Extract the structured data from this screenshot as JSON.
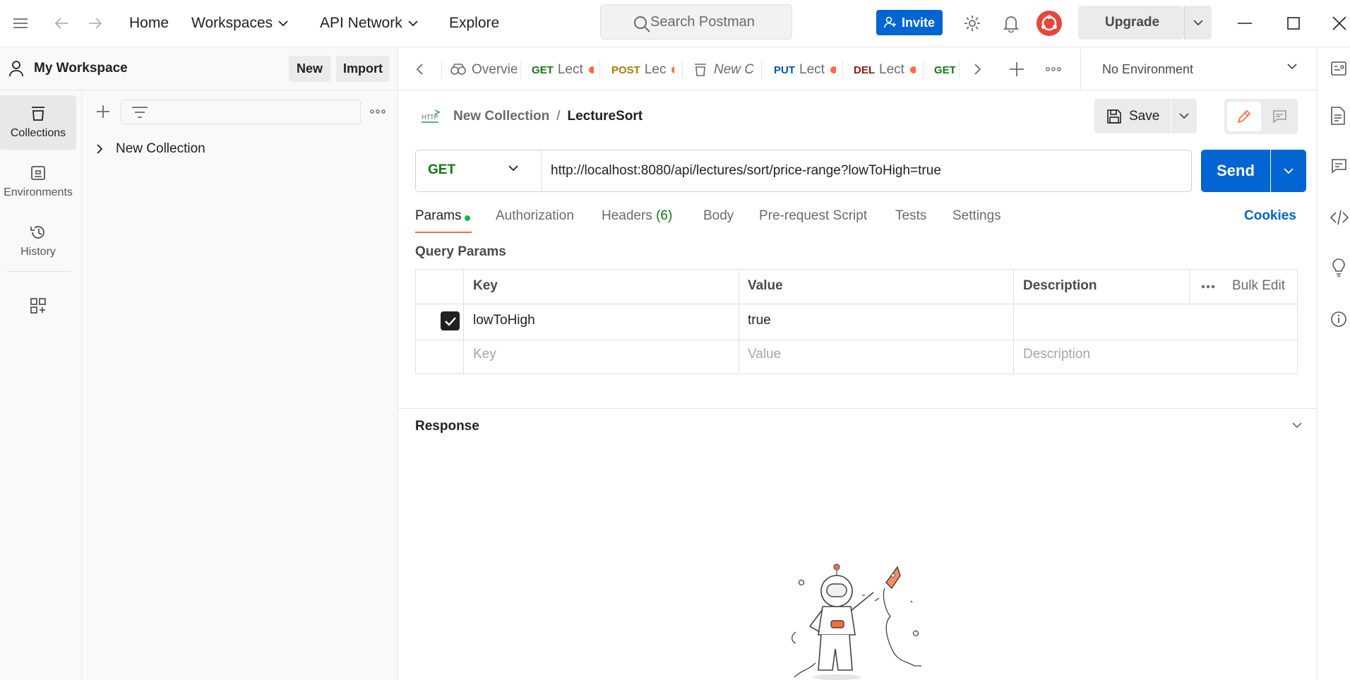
{
  "topbar": {
    "nav": {
      "home": "Home",
      "workspaces": "Workspaces",
      "api_network": "API Network",
      "explore": "Explore"
    },
    "search_placeholder": "Search Postman",
    "invite_label": "Invite",
    "upgrade_label": "Upgrade"
  },
  "workspace": {
    "title": "My Workspace",
    "new_label": "New",
    "import_label": "Import"
  },
  "rail": [
    {
      "label": "Collections",
      "icon": "collections-icon",
      "active": true
    },
    {
      "label": "Environments",
      "icon": "environments-icon",
      "active": false
    },
    {
      "label": "History",
      "icon": "history-icon",
      "active": false
    }
  ],
  "sidebar": {
    "collections": [
      {
        "name": "New Collection"
      }
    ]
  },
  "tabs": [
    {
      "method": "",
      "label": "Overvie",
      "dot": false
    },
    {
      "method": "GET",
      "label": "Lect",
      "dot": true
    },
    {
      "method": "POST",
      "label": "Lec",
      "dot": true
    },
    {
      "method": "",
      "label": "New C",
      "dot": false
    },
    {
      "method": "PUT",
      "label": "Lect",
      "dot": true
    },
    {
      "method": "DEL",
      "label": "Lect",
      "dot": true
    },
    {
      "method": "GET",
      "label": "",
      "dot": false
    }
  ],
  "environment": {
    "selected": "No Environment"
  },
  "request": {
    "breadcrumb": {
      "parent": "New Collection",
      "separator": "/",
      "current": "LectureSort"
    },
    "save_label": "Save",
    "method": "GET",
    "url": "http://localhost:8080/api/lectures/sort/price-range?lowToHigh=true",
    "send_label": "Send",
    "tabs": {
      "params": "Params",
      "authorization": "Authorization",
      "headers": "Headers",
      "headers_count": "(6)",
      "body": "Body",
      "prerequest": "Pre-request Script",
      "tests": "Tests",
      "settings": "Settings"
    },
    "cookies_label": "Cookies"
  },
  "query_params": {
    "title": "Query Params",
    "headers": {
      "key": "Key",
      "value": "Value",
      "description": "Description",
      "bulk_edit": "Bulk Edit"
    },
    "rows": [
      {
        "checked": true,
        "key": "lowToHigh",
        "value": "true",
        "description": ""
      }
    ],
    "placeholders": {
      "key": "Key",
      "value": "Value",
      "description": "Description"
    }
  },
  "response": {
    "title": "Response"
  },
  "colors": {
    "accent": "#ff6c37",
    "primary": "#0265d2",
    "get": "#0f7b0f",
    "post": "#ad7a03",
    "put": "#0053b8",
    "del": "#8e1a10"
  }
}
